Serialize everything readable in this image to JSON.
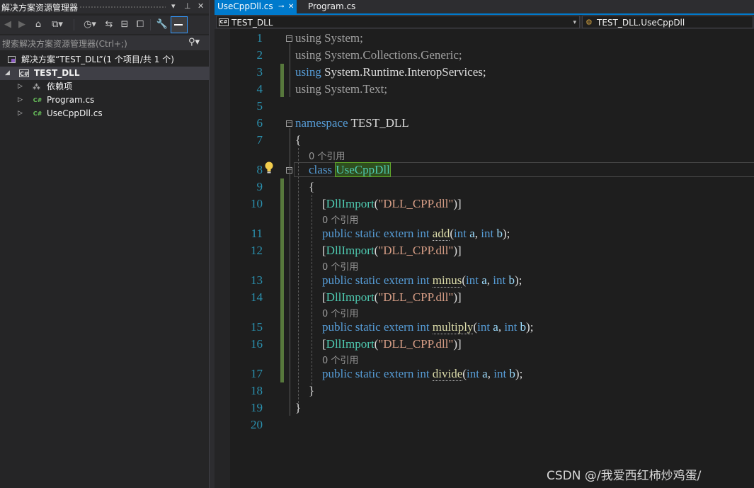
{
  "solution_explorer": {
    "title": "解决方案资源管理器",
    "title_controls": [
      "▾",
      "⊥",
      "✕"
    ],
    "search_placeholder": "搜索解决方案资源管理器(Ctrl+;)",
    "tree": [
      {
        "label": "解决方案“TEST_DLL”(1 个项目/共 1 个)"
      },
      {
        "label": "TEST_DLL",
        "badge": "C#"
      },
      {
        "label": "依赖项"
      },
      {
        "label": "Program.cs",
        "badge": "C#"
      },
      {
        "label": "UseCppDll.cs",
        "badge": "C#"
      }
    ]
  },
  "editor": {
    "tabs": [
      {
        "label": "UseCppDll.cs",
        "pin": "⊸",
        "close": "✕"
      },
      {
        "label": "Program.cs"
      }
    ],
    "nav_left": "TEST_DLL",
    "nav_right": "TEST_DLL.UseCppDll",
    "nav_left_badge": "C#",
    "line_numbers": [
      "1",
      "2",
      "3",
      "4",
      "5",
      "6",
      "7",
      "8",
      "9",
      "10",
      "11",
      "12",
      "13",
      "14",
      "15",
      "16",
      "17",
      "18",
      "19",
      "20"
    ],
    "codelens": "0 个引用",
    "code": {
      "l1_kw": "using",
      "l1_rest": " System;",
      "l2_kw": "using",
      "l2_rest": " System.Collections.Generic;",
      "l3_kw": "using",
      "l3_rest": " System.Runtime.InteropServices;",
      "l4_kw": "using",
      "l4_rest": " System.Text;",
      "l6_kw": "namespace",
      "l6_rest": " TEST_DLL",
      "open_brace": "{",
      "close_brace": "}",
      "l8_kw": "class",
      "l8_name": "UseCppDll",
      "attr_open": "[",
      "attr_name": "DllImport",
      "attr_paren": "(",
      "attr_str": "\"DLL_CPP.dll\"",
      "attr_close": ")]",
      "decl_kw": "public static extern int",
      "int_kw": "int",
      "methods": [
        "add",
        "minus",
        "multiply",
        "divide"
      ],
      "param_a": "a",
      "param_b": "b",
      "sig_open": "(",
      "sig_comma": ", ",
      "sig_close": ");"
    }
  },
  "watermark": "CSDN @/我爱西红柿炒鸡蛋/"
}
